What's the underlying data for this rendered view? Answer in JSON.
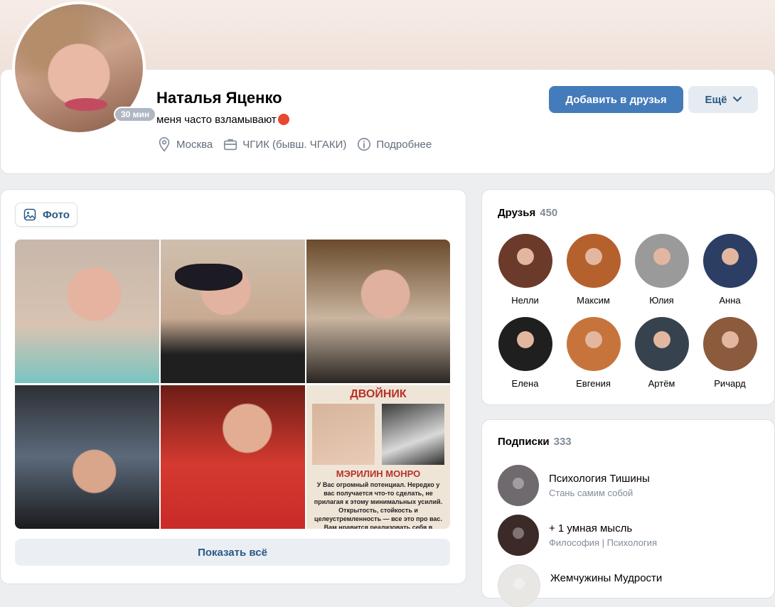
{
  "profile": {
    "name": "Наталья Яценко",
    "status": "меня часто взламывают",
    "online": "30 мин",
    "city": "Москва",
    "education": "ЧГИК (бывш. ЧГАКИ)",
    "details_link": "Подробнее",
    "add_friend_label": "Добавить в друзья",
    "more_label": "Ещё"
  },
  "photos": {
    "tab_label": "Фото",
    "show_all_label": "Показать всё",
    "card6": {
      "title": "ДВОЙНИК",
      "subtitle": "МЭРИЛИН МОНРО",
      "text": "У Вас огромный потенциал. Нередко у вас получается что-то сделать, не прилагая к этому минимальных усилий. Открытость, стойкость и целеустремленность — все это про вас. Вам нравится реализовать себя в творческих направлениях. Умеете"
    }
  },
  "friends": {
    "title": "Друзья",
    "count": "450",
    "items": [
      {
        "name": "Нелли",
        "color": "#6b3a2a"
      },
      {
        "name": "Максим",
        "color": "#b5612e"
      },
      {
        "name": "Юлия",
        "color": "#9a9a9a"
      },
      {
        "name": "Анна",
        "color": "#2c3e63"
      },
      {
        "name": "Елена",
        "color": "#1f1f1f"
      },
      {
        "name": "Евгения",
        "color": "#c7743c"
      },
      {
        "name": "Артём",
        "color": "#36434f"
      },
      {
        "name": "Ричард",
        "color": "#8c5a3c"
      }
    ]
  },
  "subscriptions": {
    "title": "Подписки",
    "count": "333",
    "items": [
      {
        "name": "Психология Тишины",
        "desc": "Стань самим собой",
        "color": "#6f6a6e"
      },
      {
        "name": "+ 1 умная мысль",
        "desc": "Философия | Психология",
        "color": "#3b2a28"
      },
      {
        "name": "Жемчужины Мудрости",
        "desc": "",
        "color": "#e9e7e4"
      }
    ]
  }
}
